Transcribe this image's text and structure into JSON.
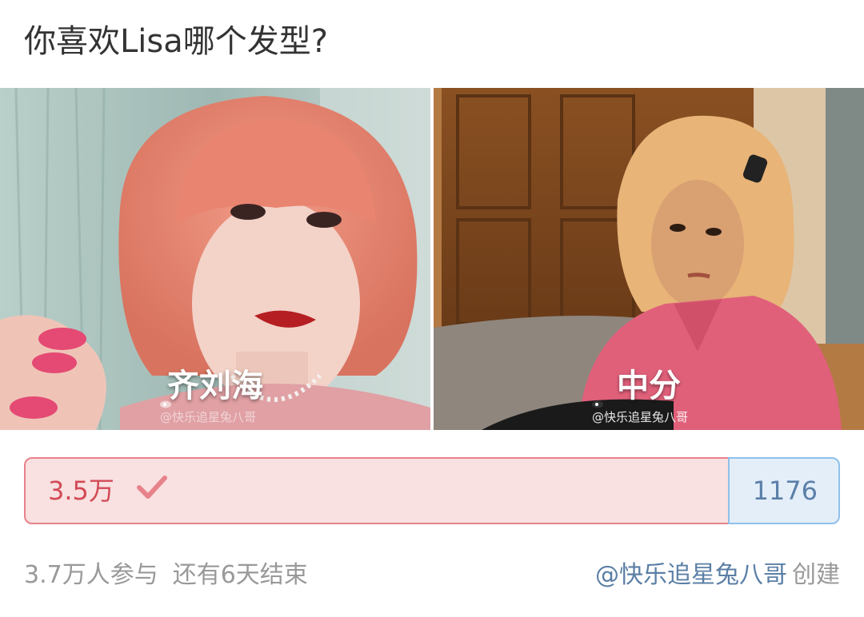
{
  "poll": {
    "title": "你喜欢Lisa哪个发型?",
    "options": [
      {
        "label": "齐刘海",
        "votes_display": "3.5万",
        "selected": true,
        "watermark": "@快乐追星兔八哥"
      },
      {
        "label": "中分",
        "votes_display": "1176",
        "selected": false,
        "watermark": "@快乐追星兔八哥"
      }
    ],
    "participants": "3.7万人参与",
    "deadline": "还有6天结束",
    "creator": "@快乐追星兔八哥",
    "created_label": "创建"
  },
  "icons": {
    "check": "check-icon",
    "weibo": "weibo-icon"
  },
  "colors": {
    "option_a_fill": "#f9e0e1",
    "option_a_border": "#e8828a",
    "option_a_text": "#d24a55",
    "option_b_fill": "#e4eef9",
    "option_b_border": "#8fc0ea",
    "option_b_text": "#5a7fa8",
    "creator_link": "#5b7fa6"
  }
}
